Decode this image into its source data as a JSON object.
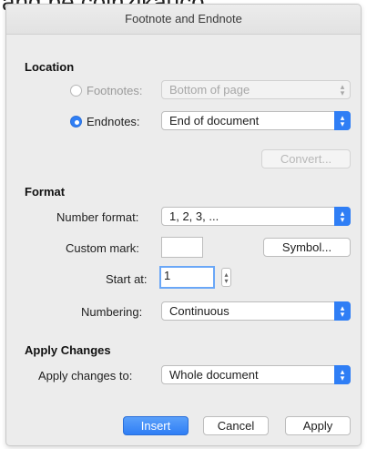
{
  "background_text": "and be colnzlkauco",
  "dialog": {
    "title": "Footnote and Endnote",
    "location": {
      "heading": "Location",
      "footnotes": {
        "label": "Footnotes:",
        "value": "Bottom of page",
        "selected": false
      },
      "endnotes": {
        "label": "Endnotes:",
        "value": "End of document",
        "selected": true
      },
      "convert_label": "Convert..."
    },
    "format": {
      "heading": "Format",
      "number_format": {
        "label": "Number format:",
        "value": "1, 2, 3, ..."
      },
      "custom_mark": {
        "label": "Custom mark:",
        "value": "",
        "symbol_label": "Symbol..."
      },
      "start_at": {
        "label": "Start at:",
        "value": "1"
      },
      "numbering": {
        "label": "Numbering:",
        "value": "Continuous"
      }
    },
    "apply_changes": {
      "heading": "Apply Changes",
      "apply_to": {
        "label": "Apply changes to:",
        "value": "Whole document"
      }
    },
    "buttons": {
      "insert": "Insert",
      "cancel": "Cancel",
      "apply": "Apply"
    },
    "colors": {
      "accent": "#2f7ef5",
      "dialog_bg": "#ececec"
    }
  }
}
